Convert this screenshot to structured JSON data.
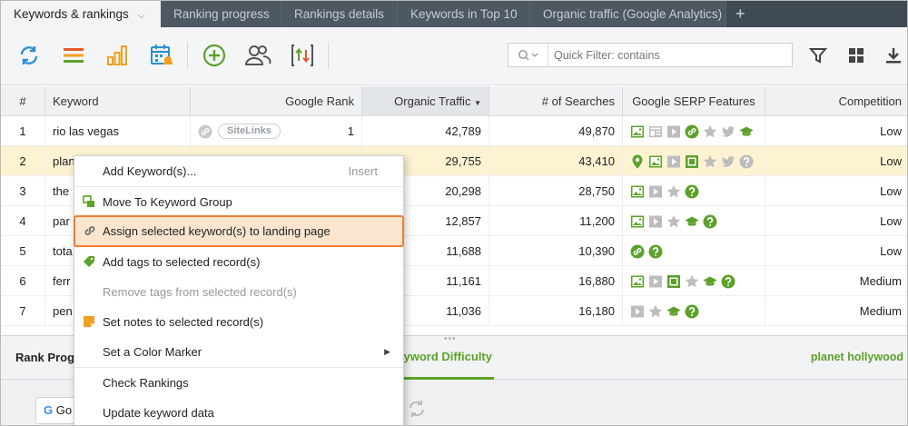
{
  "tabs": [
    {
      "label": "Keywords & rankings",
      "active": true
    },
    {
      "label": "Ranking progress"
    },
    {
      "label": "Rankings details"
    },
    {
      "label": "Keywords in Top 10"
    },
    {
      "label": "Organic traffic (Google Analytics)"
    }
  ],
  "tab_add": "+",
  "toolbar": {
    "icons": [
      "refresh-icon",
      "list-icon",
      "bar-chart-icon",
      "calendar-alert-icon",
      "add-circle-icon",
      "users-icon",
      "sort-updown-icon",
      "filter-icon",
      "grid-icon",
      "download-icon"
    ],
    "quick_filter_placeholder": "Quick Filter: contains"
  },
  "table": {
    "headers": [
      "#",
      "Keyword",
      "Google Rank",
      "Organic Traffic",
      "# of Searches",
      "Google SERP Features",
      "Competition"
    ],
    "sorted_column": "Organic Traffic",
    "rows": [
      {
        "n": "1",
        "keyword": "rio las vegas",
        "sitelinks": "SiteLinks",
        "rank": "1",
        "traffic": "42,789",
        "searches": "49,870",
        "serp": [
          "image",
          "panel",
          "video",
          "link",
          "star",
          "twitter",
          "cap"
        ],
        "competition": "Low"
      },
      {
        "n": "2",
        "keyword": "plan",
        "sitelinks": "",
        "rank": "",
        "traffic": "29,755",
        "searches": "43,410",
        "serp": [
          "pin",
          "image",
          "video",
          "square",
          "star",
          "twitter",
          "question"
        ],
        "competition": "Low"
      },
      {
        "n": "3",
        "keyword": "the",
        "sitelinks": "",
        "rank": "",
        "traffic": "20,298",
        "searches": "28,750",
        "serp": [
          "image",
          "video",
          "star",
          "question"
        ],
        "competition": "Low"
      },
      {
        "n": "4",
        "keyword": "par",
        "sitelinks": "",
        "rank": "",
        "traffic": "12,857",
        "searches": "11,200",
        "serp": [
          "image",
          "video",
          "star",
          "cap",
          "question"
        ],
        "competition": "Low"
      },
      {
        "n": "5",
        "keyword": "tota",
        "sitelinks": "",
        "rank": "",
        "traffic": "11,688",
        "searches": "10,390",
        "serp": [
          "link",
          "question"
        ],
        "competition": "Low"
      },
      {
        "n": "6",
        "keyword": "ferr",
        "sitelinks": "",
        "rank": "",
        "traffic": "11,161",
        "searches": "16,880",
        "serp": [
          "image",
          "video",
          "square",
          "star",
          "cap",
          "question"
        ],
        "competition": "Medium"
      },
      {
        "n": "7",
        "keyword": "pen",
        "sitelinks": "",
        "rank": "",
        "traffic": "11,036",
        "searches": "16,180",
        "serp": [
          "video",
          "star",
          "cap",
          "question"
        ],
        "competition": "Medium"
      }
    ]
  },
  "bottom": {
    "title": "Rank Prog",
    "tab": "eyword Difficulty",
    "keyword": "planet hollywood",
    "engine": "Go"
  },
  "context_menu": {
    "items": [
      {
        "label": "Add Keyword(s)...",
        "shortcut": "Insert"
      },
      {
        "label": "Move To Keyword Group"
      },
      {
        "label": "Assign selected keyword(s) to landing page",
        "focused": true
      },
      {
        "label": "Add tags to selected record(s)"
      },
      {
        "label": "Remove tags from selected record(s)",
        "disabled": true
      },
      {
        "label": "Set notes to selected record(s)"
      },
      {
        "label": "Set a Color Marker",
        "submenu": true
      },
      {
        "label": "Check Rankings"
      },
      {
        "label": "Update keyword data"
      }
    ]
  },
  "colors": {
    "accent_green": "#5ba12a",
    "highlight": "#fdf3d3",
    "focus_border": "#f07d2e"
  }
}
